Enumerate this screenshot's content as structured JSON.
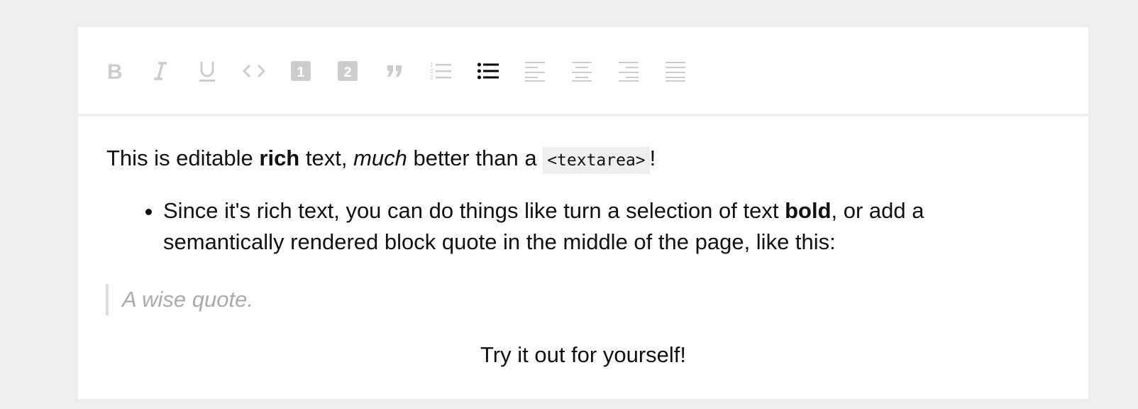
{
  "toolbar": {
    "buttons": [
      {
        "name": "bold-button",
        "icon": "format-bold-icon",
        "glyph": "B",
        "active": false
      },
      {
        "name": "italic-button",
        "icon": "format-italic-icon",
        "glyph": "I",
        "active": false
      },
      {
        "name": "underline-button",
        "icon": "format-underline-icon",
        "glyph": "U",
        "active": false
      },
      {
        "name": "code-button",
        "icon": "code-icon",
        "glyph": "<>",
        "active": false
      },
      {
        "name": "heading-one-button",
        "icon": "heading-one-icon",
        "glyph": "1",
        "active": false
      },
      {
        "name": "heading-two-button",
        "icon": "heading-two-icon",
        "glyph": "2",
        "active": false
      },
      {
        "name": "block-quote-button",
        "icon": "format-quote-icon",
        "active": false
      },
      {
        "name": "numbered-list-button",
        "icon": "numbered-list-icon",
        "active": false
      },
      {
        "name": "bulleted-list-button",
        "icon": "bulleted-list-icon",
        "active": true
      },
      {
        "name": "align-left-button",
        "icon": "align-left-icon",
        "active": false
      },
      {
        "name": "align-center-button",
        "icon": "align-center-icon",
        "active": false
      },
      {
        "name": "align-right-button",
        "icon": "align-right-icon",
        "active": false
      },
      {
        "name": "align-justify-button",
        "icon": "align-justify-icon",
        "active": false
      }
    ],
    "colors": {
      "inactive": "#cccccc",
      "active": "#000000"
    }
  },
  "content": {
    "paragraph": {
      "t1": "This is editable ",
      "bold": "rich",
      "t2": " text, ",
      "italic": "much",
      "t3": " better than a ",
      "code": "<textarea>",
      "t4": "!"
    },
    "list_item": {
      "t1": "Since it's rich text, you can do things like turn a selection of text ",
      "bold": "bold",
      "t2": ", or add a semantically rendered block quote in the middle of the page, like this:"
    },
    "quote": "A wise quote.",
    "centered": "Try it out for yourself!"
  }
}
